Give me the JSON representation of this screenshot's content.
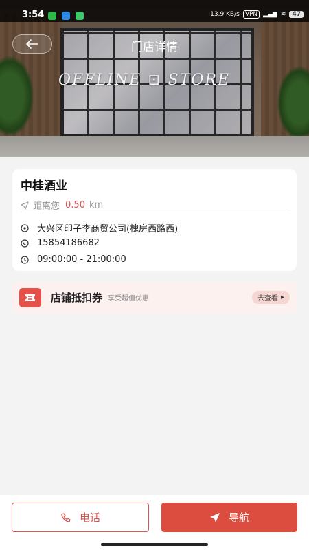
{
  "status_bar": {
    "time": "3:54",
    "network_speed": "13.9 KB/s",
    "vpn": "VPN",
    "battery": "47"
  },
  "header": {
    "title": "门店详情",
    "back_icon": "arrow-left-icon",
    "sign_text": "OFFLINE ⊡ STORE"
  },
  "store": {
    "name": "中桂酒业",
    "distance_label": "距离您",
    "distance_value": "0.50",
    "distance_unit": "km",
    "address": "大兴区印子李商贸公司(槐房西路西)",
    "phone": "15854186682",
    "hours": "09:00:00 - 21:00:00"
  },
  "coupon": {
    "title": "店铺抵扣券",
    "subtitle": "享受超值优惠",
    "action": "去查看"
  },
  "bottom": {
    "call_label": "电话",
    "navigate_label": "导航"
  },
  "colors": {
    "accent": "#dc4c3f",
    "coupon_bg": "#fdf1f0"
  }
}
